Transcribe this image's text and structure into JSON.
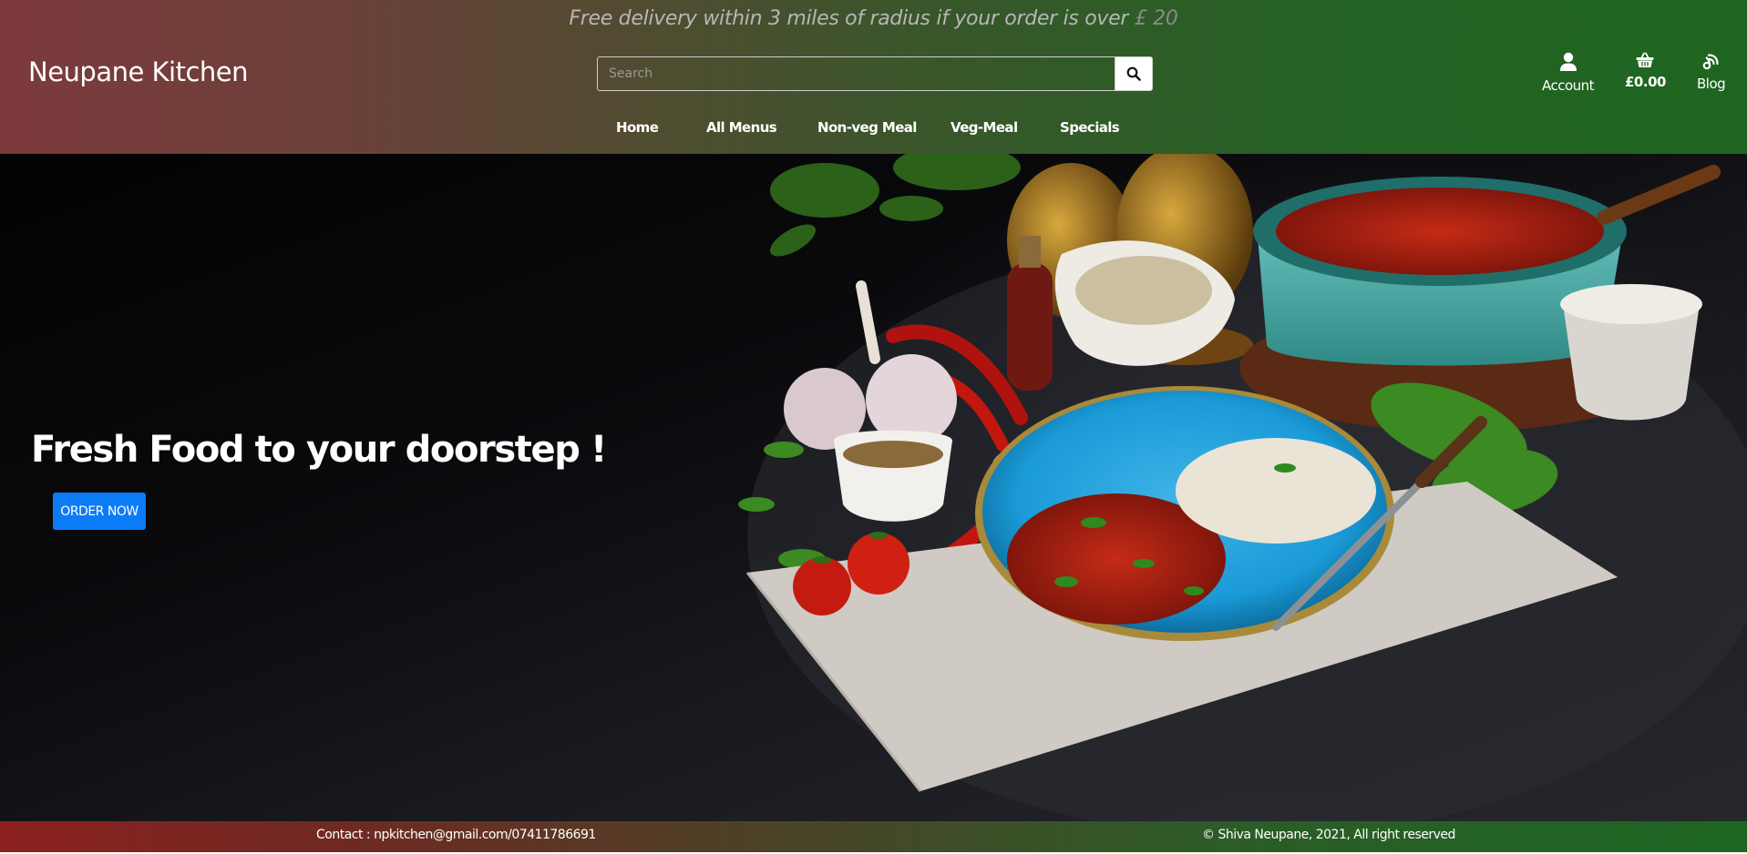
{
  "header": {
    "banner_text": "Free delivery within 3 miles of radius if your order is over",
    "banner_amount": "£ 20",
    "brand": "Neupane Kitchen",
    "search": {
      "placeholder": "Search",
      "button_icon": "search-icon"
    },
    "nav": [
      {
        "label": "Home"
      },
      {
        "label": "All Menus"
      },
      {
        "label": "Non-veg Meal"
      },
      {
        "label": "Veg-Meal"
      },
      {
        "label": "Specials"
      }
    ],
    "account": {
      "label": "Account",
      "icon": "user-icon"
    },
    "basket": {
      "label": "£0.00",
      "icon": "shopping-basket-icon"
    },
    "blog": {
      "label": "Blog",
      "icon": "blog-icon"
    }
  },
  "hero": {
    "title": "Fresh Food to your doorstep !",
    "button_label": "ORDER NOW"
  },
  "footer": {
    "contact": "Contact : npkitchen@gmail.com/07411786691",
    "copyright": "© Shiva Neupane, 2021, All right reserved"
  },
  "colors": {
    "header_left": "#7d3a3d",
    "header_right": "#1e6620",
    "footer_left": "#8c2120",
    "footer_right": "#1c6621",
    "primary_button": "#0b7cf6"
  }
}
